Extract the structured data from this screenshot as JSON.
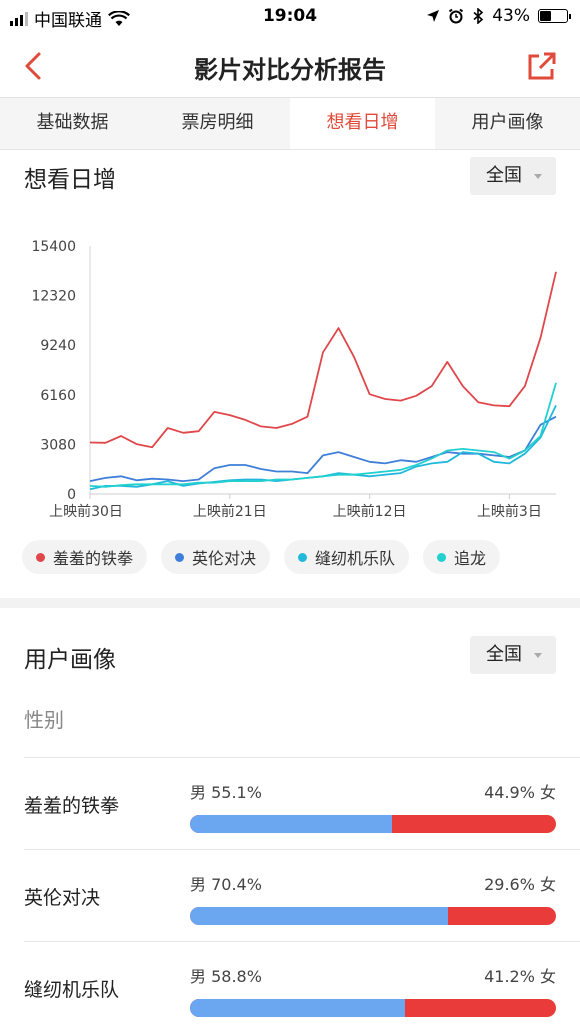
{
  "status": {
    "carrier": "中国联通",
    "time": "19:04",
    "battery": "43%",
    "battery_level": 0.43
  },
  "header": {
    "title": "影片对比分析报告",
    "back_icon": "chevron-left-icon",
    "share_icon": "external-share-icon",
    "accent": "#e04a3a"
  },
  "tabs": [
    {
      "label": "基础数据",
      "active": false
    },
    {
      "label": "票房明细",
      "active": false
    },
    {
      "label": "想看日增",
      "active": true
    },
    {
      "label": "用户画像",
      "active": false
    }
  ],
  "want_section": {
    "title": "想看日增",
    "region": "全国"
  },
  "chart_data": {
    "type": "line",
    "yticks": [
      "15400",
      "12320",
      "9240",
      "6160",
      "3080",
      "0"
    ],
    "ylim": [
      0,
      15400
    ],
    "xticks": [
      "上映前30日",
      "上映前21日",
      "上映前12日",
      "上映前3日"
    ],
    "grid": false,
    "legend_position": "bottom",
    "series": [
      {
        "name": "羞羞的铁拳",
        "color": "#e0474a",
        "values": [
          3200,
          3180,
          3600,
          3100,
          2900,
          4100,
          3800,
          3900,
          5100,
          4900,
          4600,
          4200,
          4100,
          4350,
          4800,
          8800,
          10300,
          8500,
          6200,
          5900,
          5800,
          6100,
          6700,
          8200,
          6700,
          5700,
          5500,
          5450,
          6700,
          9700,
          13800
        ]
      },
      {
        "name": "英伦对决",
        "color": "#3f7fd9",
        "values": [
          800,
          1000,
          1100,
          850,
          950,
          900,
          800,
          900,
          1600,
          1800,
          1800,
          1550,
          1400,
          1400,
          1300,
          2400,
          2600,
          2300,
          2000,
          1900,
          2100,
          2000,
          2300,
          2600,
          2500,
          2500,
          2400,
          2300,
          2700,
          4300,
          4800
        ]
      },
      {
        "name": "缝纫机乐队",
        "color": "#22b8dc",
        "values": [
          300,
          500,
          500,
          450,
          600,
          800,
          500,
          650,
          750,
          850,
          900,
          900,
          800,
          900,
          1000,
          1100,
          1300,
          1200,
          1100,
          1200,
          1300,
          1700,
          1900,
          2000,
          2600,
          2500,
          2000,
          1900,
          2500,
          3500,
          5500
        ]
      },
      {
        "name": "追龙",
        "color": "#22d0cf",
        "values": [
          500,
          450,
          550,
          600,
          600,
          600,
          600,
          700,
          700,
          800,
          800,
          800,
          900,
          900,
          1000,
          1100,
          1200,
          1200,
          1300,
          1400,
          1500,
          1800,
          2200,
          2700,
          2800,
          2700,
          2600,
          2200,
          2700,
          3600,
          6900
        ]
      }
    ]
  },
  "user_section": {
    "title": "用户画像",
    "region": "全国",
    "subtitle": "性别"
  },
  "gender": [
    {
      "movie": "羞羞的铁拳",
      "male": "男 55.1%",
      "female": "44.9% 女",
      "male_ratio": 0.551
    },
    {
      "movie": "英伦对决",
      "male": "男 70.4%",
      "female": "29.6% 女",
      "male_ratio": 0.704
    },
    {
      "movie": "缝纫机乐队",
      "male": "男 58.8%",
      "female": "41.2% 女",
      "male_ratio": 0.588
    }
  ],
  "colors": {
    "male_bar": "#6aa7f0",
    "female_bar": "#ea3b3b"
  }
}
